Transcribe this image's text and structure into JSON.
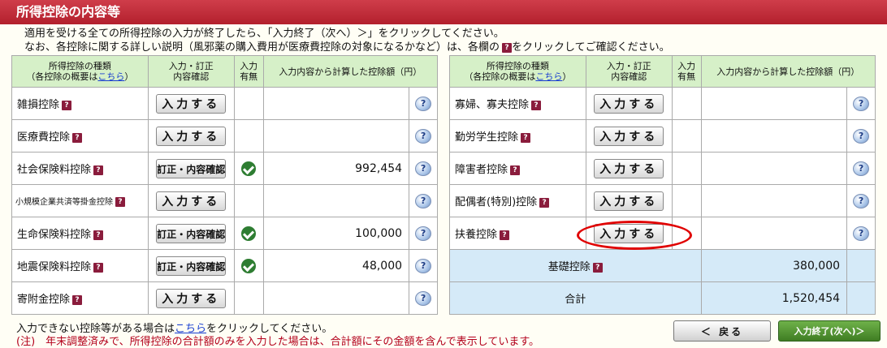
{
  "title": "所得控除の内容等",
  "intro": {
    "line1": "適用を受ける全ての所得控除の入力が終了したら、「入力終了（次へ）＞」をクリックしてください。",
    "line2a": "なお、各控除に関する詳しい説明（風邪薬の購入費用が医療費控除の対象になるかなど）は、各欄の",
    "line2b": "をクリックしてご確認ください。"
  },
  "headers": {
    "type_line1": "所得控除の種類",
    "type_line2a": "（各控除の概要は",
    "type_link": "こちら",
    "type_line2b": "）",
    "input_line1": "入力・訂正",
    "input_line2": "内容確認",
    "has_line1": "入力",
    "has_line2": "有無",
    "amount": "入力内容から計算した控除額（円）"
  },
  "buttons": {
    "input": "入力する",
    "fix": "訂正・内容確認"
  },
  "left": [
    {
      "name": "雑損控除",
      "button": "入力する",
      "amount": ""
    },
    {
      "name": "医療費控除",
      "button": "入力する",
      "amount": ""
    },
    {
      "name": "社会保険料控除",
      "button": "訂正・内容確認",
      "amount": "992,454"
    },
    {
      "name": "小規模企業共済等掛金控除",
      "button": "入力する",
      "amount": ""
    },
    {
      "name": "生命保険料控除",
      "button": "訂正・内容確認",
      "amount": "100,000"
    },
    {
      "name": "地震保険料控除",
      "button": "訂正・内容確認",
      "amount": "48,000"
    },
    {
      "name": "寄附金控除",
      "button": "入力する",
      "amount": ""
    }
  ],
  "right": [
    {
      "name": "寡婦、寡夫控除",
      "button": "入力する",
      "amount": ""
    },
    {
      "name": "勤労学生控除",
      "button": "入力する",
      "amount": ""
    },
    {
      "name": "障害者控除",
      "button": "入力する",
      "amount": ""
    },
    {
      "name": "配偶者(特別)控除",
      "button": "入力する",
      "amount": ""
    },
    {
      "name": "扶養控除",
      "button": "入力する",
      "amount": ""
    }
  ],
  "basic": {
    "name": "基礎控除",
    "amount": "380,000"
  },
  "total": {
    "name": "合計",
    "amount": "1,520,454"
  },
  "footer": {
    "line1a": "入力できない控除等がある場合は",
    "line1_link": "こちら",
    "line1b": "をクリックしてください。",
    "note": "(注)　年末調整済みで、所得控除の合計額のみを入力した場合は、合計額にその金額を含んで表示しています。"
  },
  "nav": {
    "back": "＜ 戻る",
    "next": "入力終了(次へ)＞"
  },
  "icons": {
    "question": "?",
    "help": "?"
  }
}
